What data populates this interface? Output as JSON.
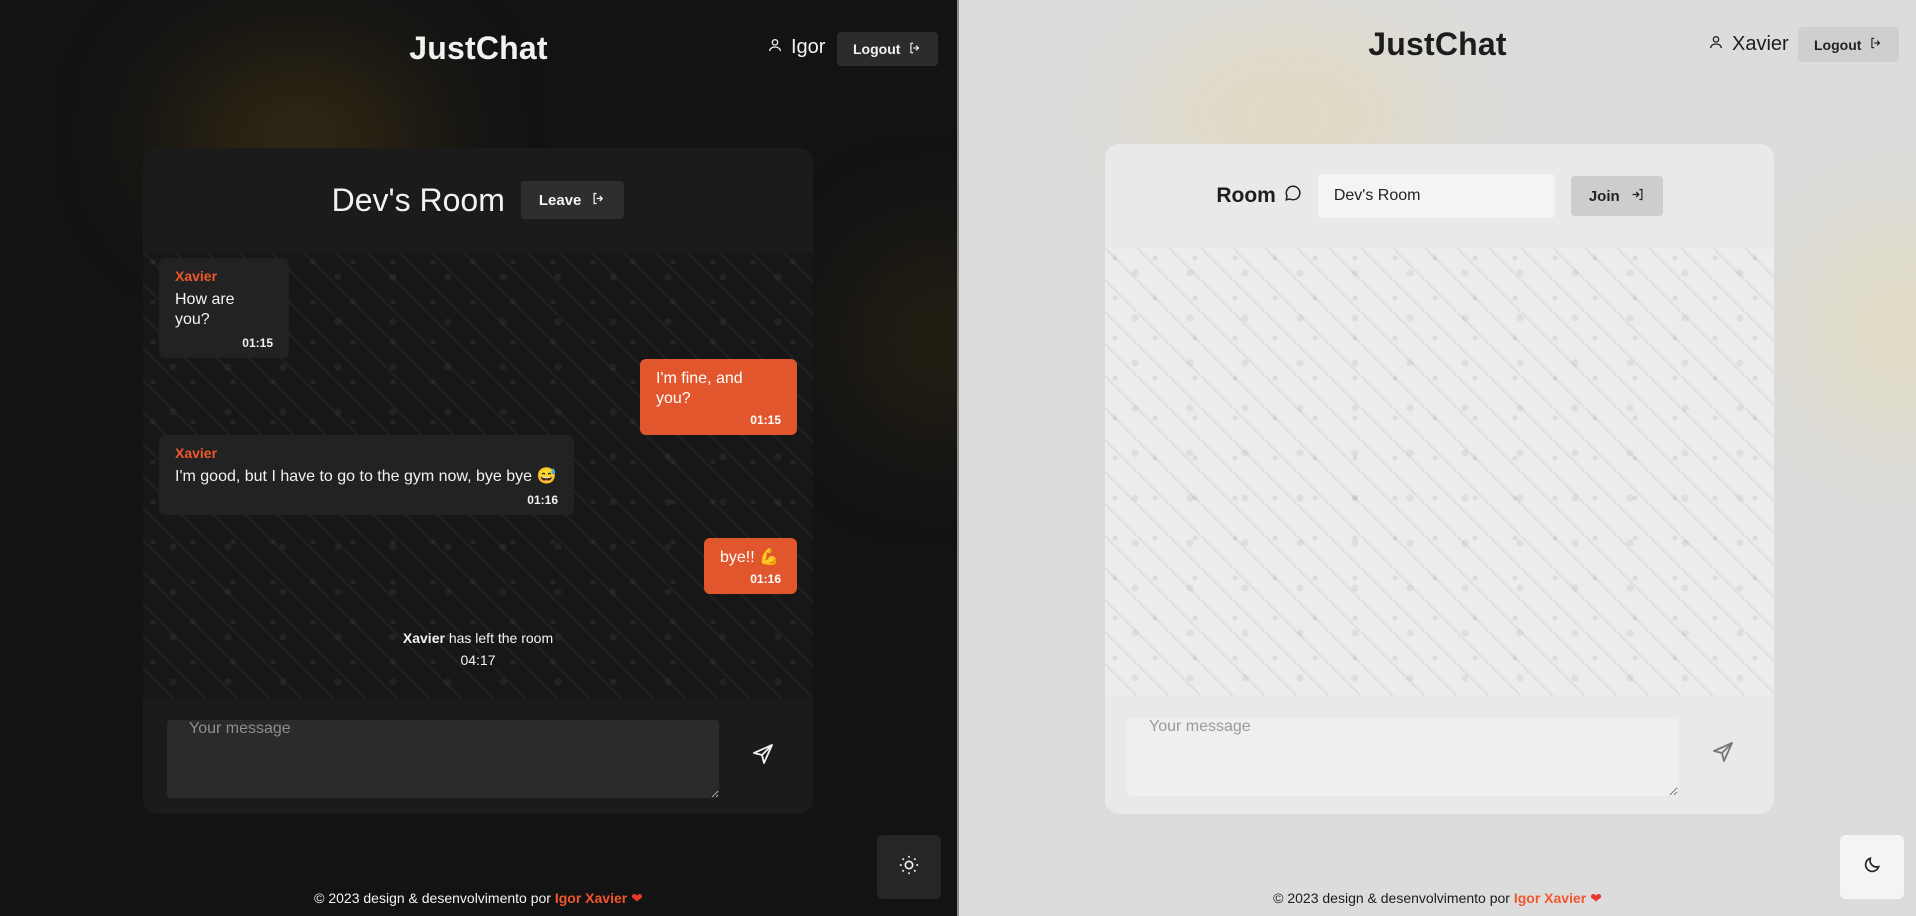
{
  "left": {
    "brand": "JustChat",
    "user_name": "Igor",
    "logout_label": "Logout",
    "room_title": "Dev's Room",
    "leave_label": "Leave",
    "messages": [
      {
        "author": "Xavier",
        "text": "How are you?",
        "time": "01:15"
      },
      {
        "text": "I'm fine, and you?",
        "time": "01:15"
      },
      {
        "author": "Xavier",
        "text": "I'm good, but I have to go to the gym now, bye bye 😅",
        "time": "01:16"
      },
      {
        "text": "bye!! 💪",
        "time": "01:16"
      }
    ],
    "system_event": {
      "name": "Xavier",
      "text": " has left the room",
      "time": "04:17"
    },
    "message_placeholder": "Your message",
    "theme_icon": "sun-icon"
  },
  "right": {
    "brand": "JustChat",
    "user_name": "Xavier",
    "logout_label": "Logout",
    "room_label": "Room",
    "room_input_value": "Dev's Room",
    "join_label": "Join",
    "message_placeholder": "Your message",
    "theme_icon": "moon-icon"
  },
  "footer": {
    "prefix": "© 2023 design & desenvolvimento por",
    "author": "Igor Xavier",
    "heart": "❤"
  },
  "colors": {
    "accent": "#e1562c",
    "dark_bg": "#131313",
    "light_bg": "#dcdcdc"
  }
}
